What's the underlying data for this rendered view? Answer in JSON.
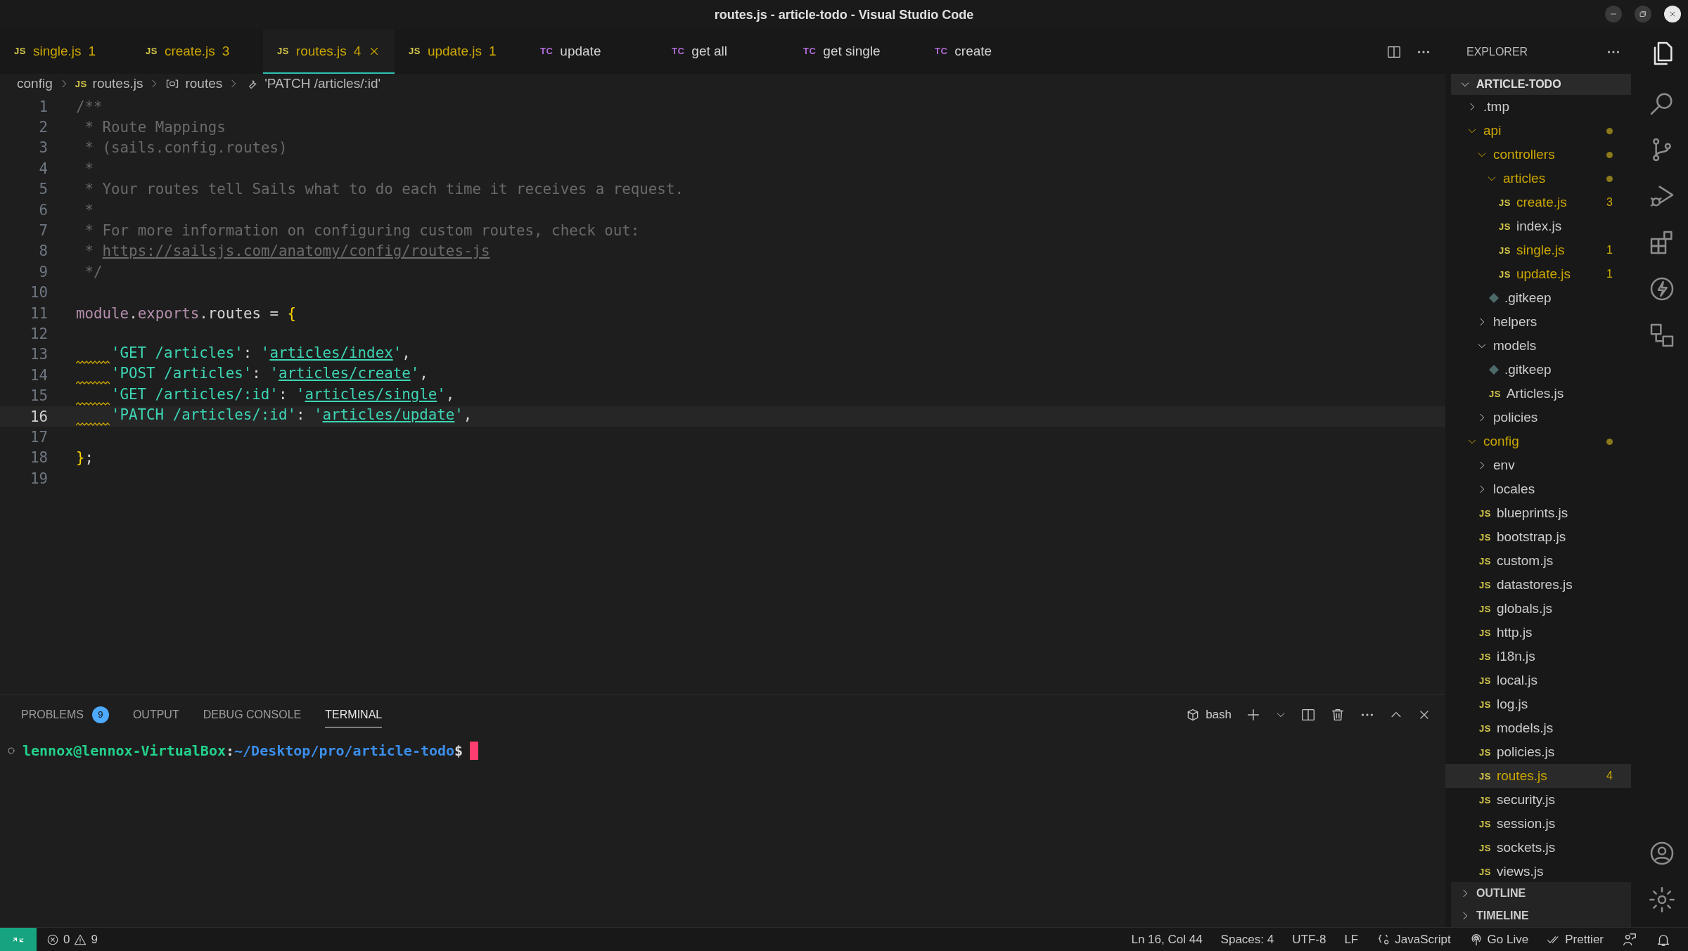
{
  "window": {
    "title": "routes.js - article-todo - Visual Studio Code"
  },
  "tabs": [
    {
      "kind": "js",
      "icon_text": "JS",
      "label": "single.js",
      "badge": "1",
      "warning": true,
      "selected": false
    },
    {
      "kind": "js",
      "icon_text": "JS",
      "label": "create.js",
      "badge": "3",
      "warning": true,
      "selected": false
    },
    {
      "kind": "js",
      "icon_text": "JS",
      "label": "routes.js",
      "badge": "4",
      "warning": true,
      "selected": true
    },
    {
      "kind": "js",
      "icon_text": "JS",
      "label": "update.js",
      "badge": "1",
      "warning": true,
      "selected": false
    },
    {
      "kind": "tc",
      "icon_text": "TC",
      "label": "update",
      "warning": false,
      "selected": false
    },
    {
      "kind": "tc",
      "icon_text": "TC",
      "label": "get all",
      "warning": false,
      "selected": false
    },
    {
      "kind": "tc",
      "icon_text": "TC",
      "label": "get single",
      "warning": false,
      "selected": false
    },
    {
      "kind": "tc",
      "icon_text": "TC",
      "label": "create",
      "warning": false,
      "selected": false
    }
  ],
  "breadcrumb": [
    {
      "kind": "folder",
      "label": "config"
    },
    {
      "kind": "js",
      "icon_text": "JS",
      "label": "routes.js"
    },
    {
      "kind": "variable",
      "label": "routes"
    },
    {
      "kind": "property",
      "label": "'PATCH /articles/:id'"
    }
  ],
  "editor": {
    "lines": [
      {
        "number": "1",
        "current": false,
        "warning": false,
        "tokens": [
          {
            "kind": "comment",
            "text": "/**"
          }
        ]
      },
      {
        "number": "2",
        "current": false,
        "warning": false,
        "tokens": [
          {
            "kind": "comment",
            "text": " * Route Mappings"
          }
        ]
      },
      {
        "number": "3",
        "current": false,
        "warning": false,
        "tokens": [
          {
            "kind": "comment",
            "text": " * (sails.config.routes)"
          }
        ]
      },
      {
        "number": "4",
        "current": false,
        "warning": false,
        "tokens": [
          {
            "kind": "comment",
            "text": " *"
          }
        ]
      },
      {
        "number": "5",
        "current": false,
        "warning": false,
        "tokens": [
          {
            "kind": "comment",
            "text": " * Your routes tell Sails what to do each time it receives a request."
          }
        ]
      },
      {
        "number": "6",
        "current": false,
        "warning": false,
        "tokens": [
          {
            "kind": "comment",
            "text": " *"
          }
        ]
      },
      {
        "number": "7",
        "current": false,
        "warning": false,
        "tokens": [
          {
            "kind": "comment",
            "text": " * For more information on configuring custom routes, check out:"
          }
        ]
      },
      {
        "number": "8",
        "current": false,
        "warning": false,
        "tokens": [
          {
            "kind": "comment",
            "text": " * "
          },
          {
            "kind": "link",
            "text": "https://sailsjs.com/anatomy/config/routes-js"
          }
        ]
      },
      {
        "number": "9",
        "current": false,
        "warning": false,
        "tokens": [
          {
            "kind": "comment",
            "text": " */"
          }
        ]
      },
      {
        "number": "10",
        "current": false,
        "warning": false
      },
      {
        "number": "11",
        "current": false,
        "warning": false,
        "tokens": [
          {
            "kind": "var",
            "text": "module"
          },
          {
            "kind": "plain",
            "text": "."
          },
          {
            "kind": "var",
            "text": "exports"
          },
          {
            "kind": "plain",
            "text": ".routes = "
          },
          {
            "kind": "brace",
            "text": "{"
          }
        ]
      },
      {
        "number": "12",
        "current": false,
        "warning": false
      },
      {
        "number": "13",
        "current": false,
        "warning": true,
        "tokens": [
          {
            "kind": "string",
            "text": "'GET /articles'"
          },
          {
            "kind": "plain",
            "text": ": "
          },
          {
            "kind": "string",
            "text": "'"
          },
          {
            "kind": "path",
            "text": "articles/index"
          },
          {
            "kind": "string",
            "text": "'"
          },
          {
            "kind": "plain",
            "text": ","
          }
        ]
      },
      {
        "number": "14",
        "current": false,
        "warning": true,
        "tokens": [
          {
            "kind": "string",
            "text": "'POST /articles'"
          },
          {
            "kind": "plain",
            "text": ": "
          },
          {
            "kind": "string",
            "text": "'"
          },
          {
            "kind": "path",
            "text": "articles/create"
          },
          {
            "kind": "string",
            "text": "'"
          },
          {
            "kind": "plain",
            "text": ","
          }
        ]
      },
      {
        "number": "15",
        "current": false,
        "warning": true,
        "tokens": [
          {
            "kind": "string",
            "text": "'GET /articles/:id'"
          },
          {
            "kind": "plain",
            "text": ": "
          },
          {
            "kind": "string",
            "text": "'"
          },
          {
            "kind": "path",
            "text": "articles/single"
          },
          {
            "kind": "string",
            "text": "'"
          },
          {
            "kind": "plain",
            "text": ","
          }
        ]
      },
      {
        "number": "16",
        "current": true,
        "warning": true,
        "tokens": [
          {
            "kind": "string",
            "text": "'PATCH /articles/:id'"
          },
          {
            "kind": "plain",
            "text": ": "
          },
          {
            "kind": "string",
            "text": "'"
          },
          {
            "kind": "path",
            "text": "articles/update"
          },
          {
            "kind": "string",
            "text": "'"
          },
          {
            "kind": "plain",
            "text": ","
          }
        ]
      },
      {
        "number": "17",
        "current": false,
        "warning": false
      },
      {
        "number": "18",
        "current": false,
        "warning": false,
        "tokens": [
          {
            "kind": "brace",
            "text": "}"
          },
          {
            "kind": "plain",
            "text": ";"
          }
        ]
      },
      {
        "number": "19",
        "current": false,
        "warning": false
      }
    ]
  },
  "panel": {
    "tabs": [
      {
        "label": "PROBLEMS",
        "badge": "9",
        "selected": false
      },
      {
        "label": "OUTPUT",
        "selected": false
      },
      {
        "label": "DEBUG CONSOLE",
        "selected": false
      },
      {
        "label": "TERMINAL",
        "selected": true
      }
    ],
    "shell": "bash",
    "terminal": {
      "user": "lennox@lennox-VirtualBox",
      "separator": ":",
      "path": "~/Desktop/pro/article-todo",
      "prompt": "$"
    }
  },
  "explorer": {
    "title": "EXPLORER",
    "root": {
      "label": "ARTICLE-TODO",
      "expanded": true
    },
    "tree": [
      {
        "kind": "folder",
        "label": ".tmp",
        "expanded": false,
        "modified": false,
        "selected": false
      },
      {
        "kind": "folder",
        "label": "api",
        "expanded": true,
        "modified": true,
        "selected": false,
        "children": [
          {
            "kind": "folder",
            "label": "controllers",
            "expanded": true,
            "modified": true,
            "selected": false,
            "children": [
              {
                "kind": "folder",
                "label": "articles",
                "expanded": true,
                "modified": true,
                "selected": false,
                "children": [
                  {
                    "kind": "js",
                    "icon_text": "JS",
                    "label": "create.js",
                    "badge": "3",
                    "modified": true,
                    "selected": false
                  },
                  {
                    "kind": "js",
                    "icon_text": "JS",
                    "label": "index.js",
                    "modified": false,
                    "selected": false
                  },
                  {
                    "kind": "js",
                    "icon_text": "JS",
                    "label": "single.js",
                    "badge": "1",
                    "modified": true,
                    "selected": false
                  },
                  {
                    "kind": "js",
                    "icon_text": "JS",
                    "label": "update.js",
                    "badge": "1",
                    "modified": true,
                    "selected": false
                  }
                ]
              },
              {
                "kind": "gitkeep",
                "label": ".gitkeep",
                "modified": false,
                "selected": false
              }
            ]
          },
          {
            "kind": "folder",
            "label": "helpers",
            "expanded": false,
            "modified": false,
            "selected": false
          },
          {
            "kind": "folder",
            "label": "models",
            "expanded": true,
            "modified": false,
            "selected": false,
            "children": [
              {
                "kind": "gitkeep",
                "label": ".gitkeep",
                "modified": false,
                "selected": false
              },
              {
                "kind": "js",
                "icon_text": "JS",
                "label": "Articles.js",
                "modified": false,
                "selected": false
              }
            ]
          },
          {
            "kind": "folder",
            "label": "policies",
            "expanded": false,
            "modified": false,
            "selected": false
          }
        ]
      },
      {
        "kind": "folder",
        "label": "config",
        "expanded": true,
        "modified": true,
        "selected": false,
        "children": [
          {
            "kind": "folder",
            "label": "env",
            "expanded": false,
            "modified": false,
            "selected": false
          },
          {
            "kind": "folder",
            "label": "locales",
            "expanded": false,
            "modified": false,
            "selected": false
          },
          {
            "kind": "js",
            "icon_text": "JS",
            "label": "blueprints.js",
            "modified": false,
            "selected": false
          },
          {
            "kind": "js",
            "icon_text": "JS",
            "label": "bootstrap.js",
            "modified": false,
            "selected": false
          },
          {
            "kind": "js",
            "icon_text": "JS",
            "label": "custom.js",
            "modified": false,
            "selected": false
          },
          {
            "kind": "js",
            "icon_text": "JS",
            "label": "datastores.js",
            "modified": false,
            "selected": false
          },
          {
            "kind": "js",
            "icon_text": "JS",
            "label": "globals.js",
            "modified": false,
            "selected": false
          },
          {
            "kind": "js",
            "icon_text": "JS",
            "label": "http.js",
            "modified": false,
            "selected": false
          },
          {
            "kind": "js",
            "icon_text": "JS",
            "label": "i18n.js",
            "modified": false,
            "selected": false
          },
          {
            "kind": "js",
            "icon_text": "JS",
            "label": "local.js",
            "modified": false,
            "selected": false
          },
          {
            "kind": "js",
            "icon_text": "JS",
            "label": "log.js",
            "modified": false,
            "selected": false
          },
          {
            "kind": "js",
            "icon_text": "JS",
            "label": "models.js",
            "modified": false,
            "selected": false
          },
          {
            "kind": "js",
            "icon_text": "JS",
            "label": "policies.js",
            "modified": false,
            "selected": false
          },
          {
            "kind": "js",
            "icon_text": "JS",
            "label": "routes.js",
            "badge": "4",
            "modified": true,
            "selected": true
          },
          {
            "kind": "js",
            "icon_text": "JS",
            "label": "security.js",
            "modified": false,
            "selected": false
          },
          {
            "kind": "js",
            "icon_text": "JS",
            "label": "session.js",
            "modified": false,
            "selected": false
          },
          {
            "kind": "js",
            "icon_text": "JS",
            "label": "sockets.js",
            "modified": false,
            "selected": false
          },
          {
            "kind": "js",
            "icon_text": "JS",
            "label": "views.js",
            "modified": false,
            "selected": false
          }
        ]
      }
    ],
    "sections": [
      {
        "label": "OUTLINE",
        "expanded": false
      },
      {
        "label": "TIMELINE",
        "expanded": false
      }
    ]
  },
  "status_bar": {
    "errors": "0",
    "warnings": "9",
    "items": [
      {
        "kind": "text",
        "label": "Ln 16, Col 44"
      },
      {
        "kind": "text",
        "label": "Spaces: 4"
      },
      {
        "kind": "text",
        "label": "UTF-8"
      },
      {
        "kind": "text",
        "label": "LF"
      },
      {
        "kind": "language",
        "label": "JavaScript"
      },
      {
        "kind": "live",
        "label": "Go Live"
      },
      {
        "kind": "prettier",
        "label": "Prettier"
      }
    ]
  }
}
